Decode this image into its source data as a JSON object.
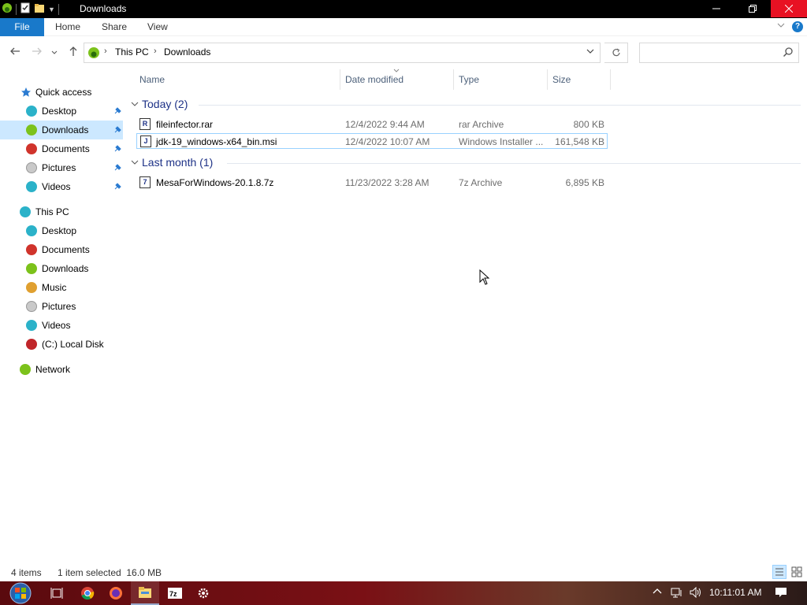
{
  "window": {
    "title": "Downloads",
    "controls": [
      "minimize-icon",
      "restore-icon",
      "close-icon"
    ]
  },
  "ribbon": {
    "tabs": [
      {
        "label": "File",
        "active": true
      },
      {
        "label": "Home"
      },
      {
        "label": "Share"
      },
      {
        "label": "View"
      }
    ],
    "help_label": "?"
  },
  "address": {
    "crumbs": [
      "This PC",
      "Downloads"
    ],
    "search_placeholder": ""
  },
  "sidebar": {
    "quick_access": {
      "label": "Quick access",
      "items": [
        {
          "label": "Desktop",
          "pinned": true,
          "icon_color": "#2bb2c9"
        },
        {
          "label": "Downloads",
          "pinned": true,
          "selected": true,
          "icon_color": "#7cc21b"
        },
        {
          "label": "Documents",
          "pinned": true,
          "icon_color": "#d0342c"
        },
        {
          "label": "Pictures",
          "pinned": true,
          "icon_color": "#c9c9c9"
        },
        {
          "label": "Videos",
          "pinned": true,
          "icon_color": "#2bb2c9"
        }
      ]
    },
    "this_pc": {
      "label": "This PC",
      "items": [
        {
          "label": "Desktop",
          "icon_color": "#2bb2c9"
        },
        {
          "label": "Documents",
          "icon_color": "#d0342c"
        },
        {
          "label": "Downloads",
          "icon_color": "#7cc21b"
        },
        {
          "label": "Music",
          "icon_color": "#e0a030"
        },
        {
          "label": "Pictures",
          "icon_color": "#c9c9c9"
        },
        {
          "label": "Videos",
          "icon_color": "#2bb2c9"
        },
        {
          "label": "(C:) Local Disk",
          "icon_color": "#c0262a"
        }
      ]
    },
    "network": {
      "label": "Network"
    }
  },
  "columns": {
    "name": "Name",
    "date": "Date modified",
    "type": "Type",
    "size": "Size"
  },
  "groups": [
    {
      "label": "Today (2)",
      "files": [
        {
          "name": "fileinfector.rar",
          "date": "12/4/2022 9:44 AM",
          "type": "rar Archive",
          "size": "800 KB",
          "icon": "R"
        },
        {
          "name": "jdk-19_windows-x64_bin.msi",
          "date": "12/4/2022 10:07 AM",
          "type": "Windows Installer ...",
          "size": "161,548 KB",
          "icon": "J",
          "selected": true
        }
      ]
    },
    {
      "label": "Last month (1)",
      "files": [
        {
          "name": "MesaForWindows-20.1.8.7z",
          "date": "11/23/2022 3:28 AM",
          "type": "7z Archive",
          "size": "6,895 KB",
          "icon": "7"
        }
      ]
    }
  ],
  "status": {
    "count": "4 items",
    "selection": "1 item selected  16.0 MB"
  },
  "taskbar": {
    "clock": "10:11:01 AM",
    "apps": [
      "start-orb-icon",
      "task-view-icon",
      "chrome-icon",
      "firefox-icon",
      "file-explorer-icon",
      "7zip-icon",
      "settings-icon"
    ]
  }
}
